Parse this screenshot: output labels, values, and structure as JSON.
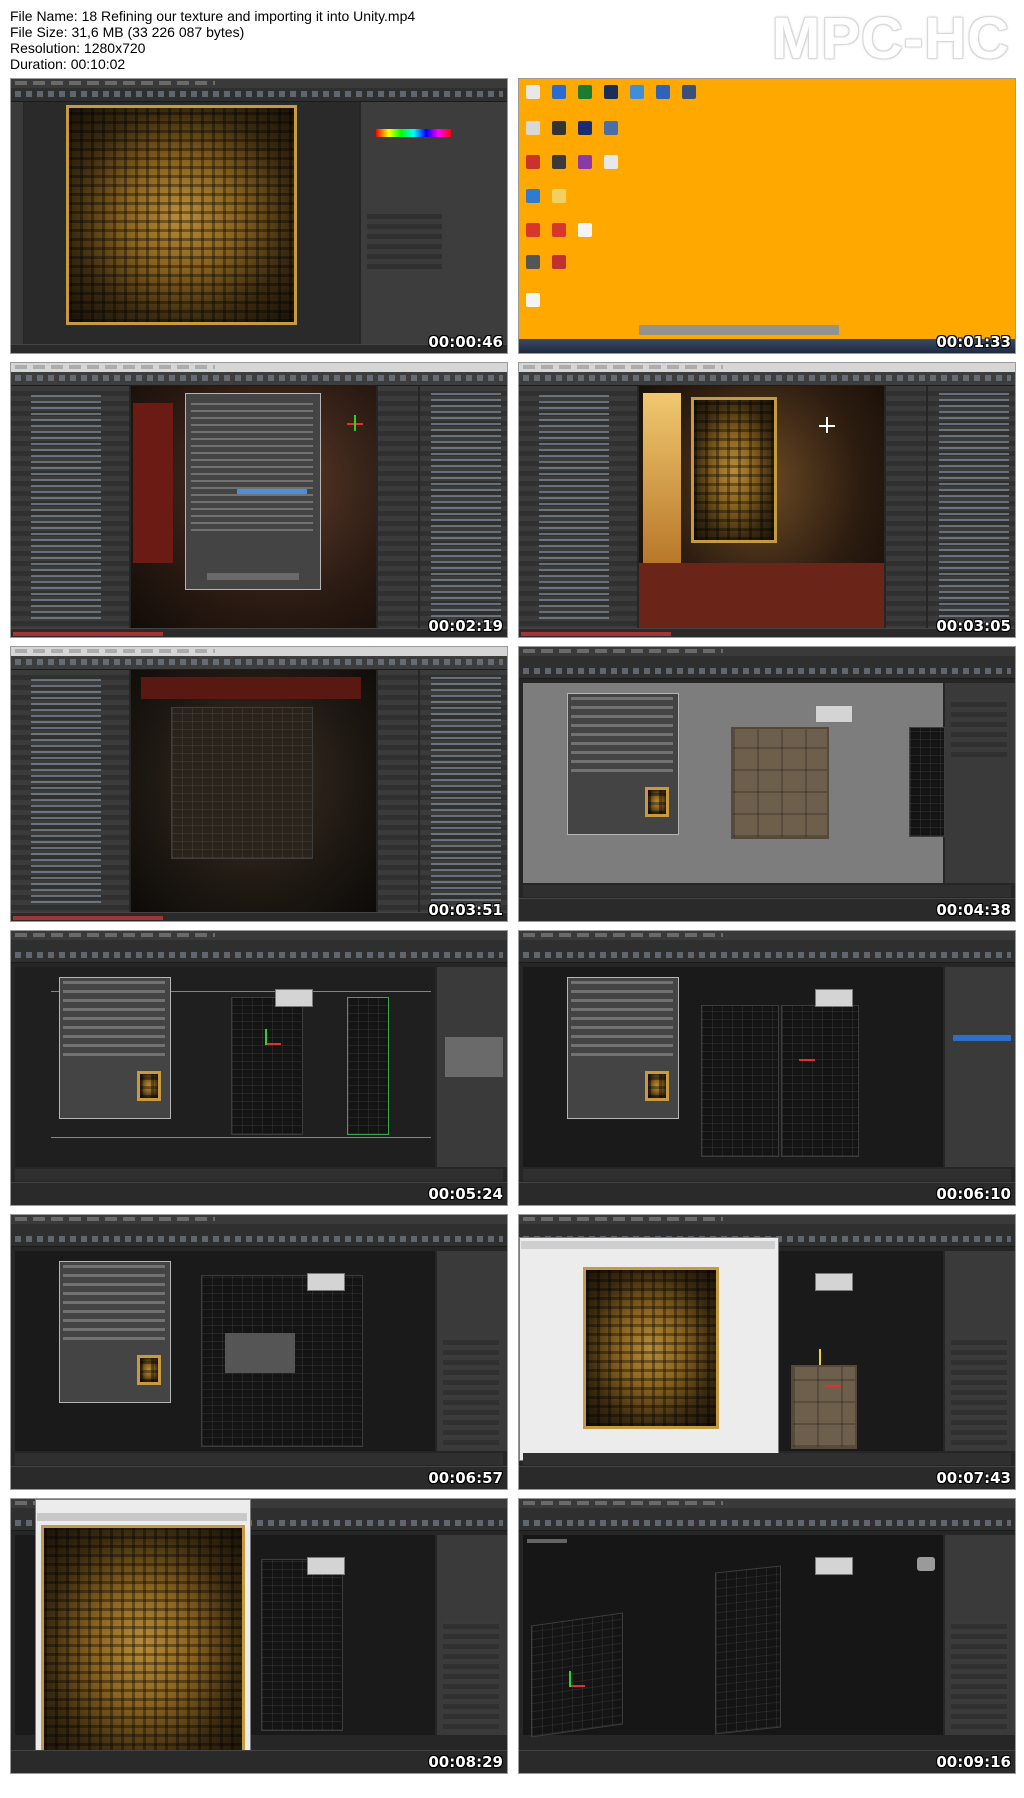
{
  "header": {
    "file_name": "File Name: 18 Refining our texture and importing it into Unity.mp4",
    "file_size": "File Size: 31,6 MB (33 226 087 bytes)",
    "resolution": "Resolution: 1280x720",
    "duration": "Duration: 00:10:02",
    "logo": "MPC-HC"
  },
  "thumbnails": [
    {
      "timestamp": "00:00:46",
      "app": "photoshop"
    },
    {
      "timestamp": "00:01:33",
      "app": "desktop",
      "desktop_color": "#ffa800"
    },
    {
      "timestamp": "00:02:19",
      "app": "unity"
    },
    {
      "timestamp": "00:03:05",
      "app": "unity"
    },
    {
      "timestamp": "00:03:51",
      "app": "unity"
    },
    {
      "timestamp": "00:04:38",
      "app": "3dsmax"
    },
    {
      "timestamp": "00:05:24",
      "app": "3dsmax"
    },
    {
      "timestamp": "00:06:10",
      "app": "3dsmax"
    },
    {
      "timestamp": "00:06:57",
      "app": "3dsmax"
    },
    {
      "timestamp": "00:07:43",
      "app": "3dsmax"
    },
    {
      "timestamp": "00:08:29",
      "app": "3dsmax"
    },
    {
      "timestamp": "00:09:16",
      "app": "3dsmax"
    }
  ]
}
